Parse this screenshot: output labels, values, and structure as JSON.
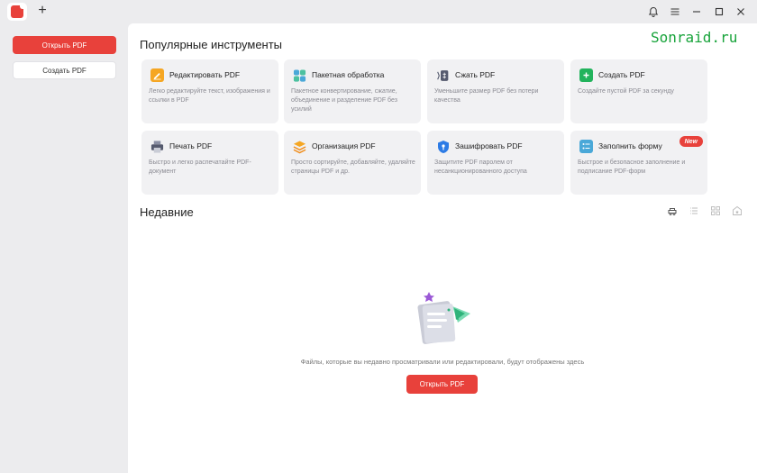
{
  "colors": {
    "accent": "#e8413b",
    "watermark": "#17a33a"
  },
  "titlebar": {
    "new_tab": "+",
    "icons": [
      "bell-icon",
      "menu-icon",
      "minimize-icon",
      "maximize-icon",
      "close-icon"
    ]
  },
  "sidebar": {
    "open_label": "Открыть PDF",
    "create_label": "Создать PDF"
  },
  "watermark": "Sonraid.ru",
  "popular": {
    "title": "Популярные инструменты",
    "cards": [
      {
        "icon": "edit-icon",
        "title": "Редактировать PDF",
        "desc": "Легко редактируйте текст, изображения и ссылки в PDF"
      },
      {
        "icon": "batch-icon",
        "title": "Пакетная обработка",
        "desc": "Пакетное конвертирование, сжатие, объединение и разделение PDF без усилий"
      },
      {
        "icon": "compress-icon",
        "title": "Сжать PDF",
        "desc": "Уменьшите размер PDF без потери качества"
      },
      {
        "icon": "create-icon",
        "title": "Создать PDF",
        "desc": "Создайте пустой PDF за секунду"
      },
      {
        "icon": "print-icon",
        "title": "Печать PDF",
        "desc": "Быстро и легко распечатайте PDF-документ"
      },
      {
        "icon": "organize-icon",
        "title": "Организация PDF",
        "desc": "Просто сортируйте, добавляйте, удаляйте страницы PDF и др."
      },
      {
        "icon": "encrypt-icon",
        "title": "Зашифровать PDF",
        "desc": "Защитите PDF паролем от несанкционированного доступа"
      },
      {
        "icon": "form-icon",
        "title": "Заполнить форму",
        "desc": "Быстрое и безопасное заполнение и подписание PDF-форм",
        "badge": "New"
      }
    ]
  },
  "recent": {
    "title": "Недавние",
    "view_icons": [
      "cloud-icon",
      "list-view-icon",
      "grid-view-icon",
      "starred-icon"
    ],
    "empty_text": "Файлы, которые вы недавно просматривали или редактировали, будут отображены здесь",
    "open_label": "Открыть PDF"
  }
}
